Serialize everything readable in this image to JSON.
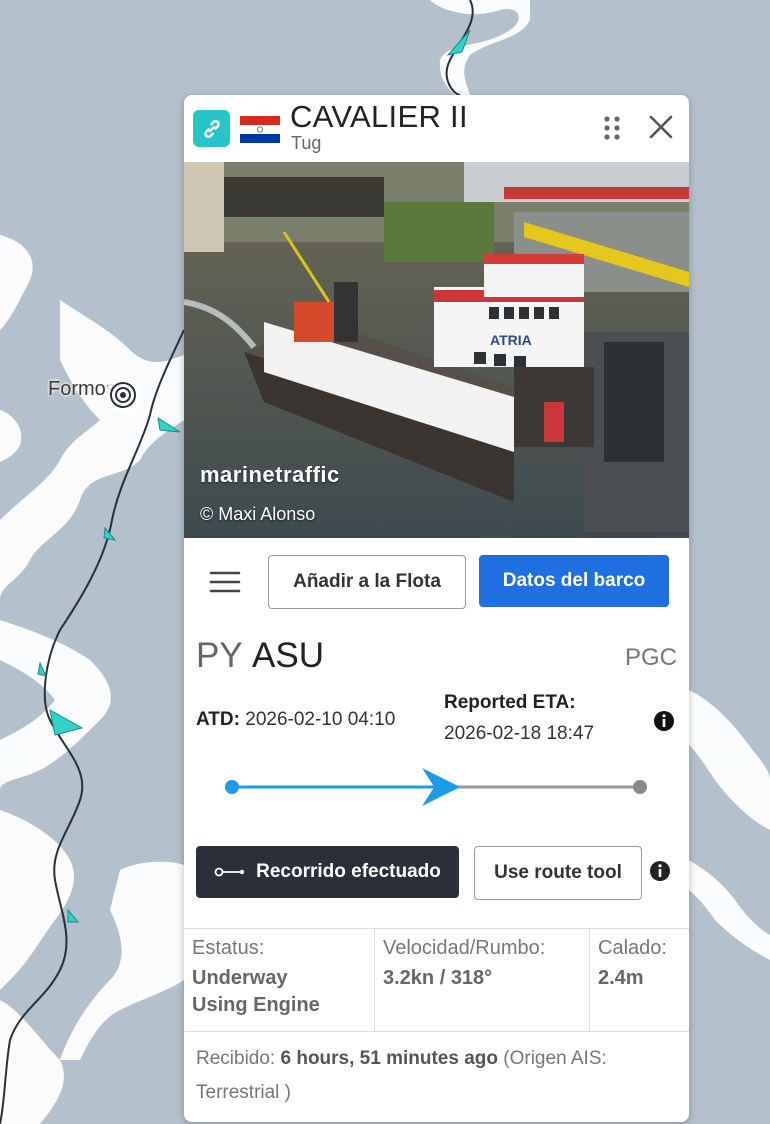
{
  "map": {
    "city_label": "Formosa",
    "background_color": "#b4c0cc"
  },
  "panel": {
    "vessel_name": "CAVALIER II",
    "vessel_type": "Tug",
    "flag_country": "Paraguay",
    "photo": {
      "brand": "marinetraffic",
      "credit": "© Maxi Alonso",
      "ship_label": "ATRIA"
    },
    "actions": {
      "add_fleet_label": "Añadir a la Flota",
      "ship_data_label": "Datos del barco"
    },
    "route": {
      "origin_country": "PY",
      "origin_port": "ASU",
      "destination": "PGC"
    },
    "times": {
      "atd_label": "ATD:",
      "atd_value": "2026-02-10 04:10",
      "eta_label": "Reported ETA:",
      "eta_value": "2026-02-18 18:47"
    },
    "progress_fraction": 0.52,
    "route_buttons": {
      "track_label": "Recorrido efectuado",
      "route_tool_label": "Use route tool"
    },
    "stats": {
      "status_label": "Estatus:",
      "status_value": "Underway Using Engine",
      "speed_label": "Velocidad/Rumbo:",
      "speed_value": "3.2kn / 318°",
      "draught_label": "Calado:",
      "draught_value": "2.4m"
    },
    "received": {
      "label": "Recibido:",
      "value": "6 hours, 51 minutes ago",
      "source": "(Origen AIS: Terrestrial )"
    }
  },
  "colors": {
    "accent_blue": "#1f6fe0",
    "teal": "#25c5c9",
    "dark_button": "#2b2f39"
  }
}
